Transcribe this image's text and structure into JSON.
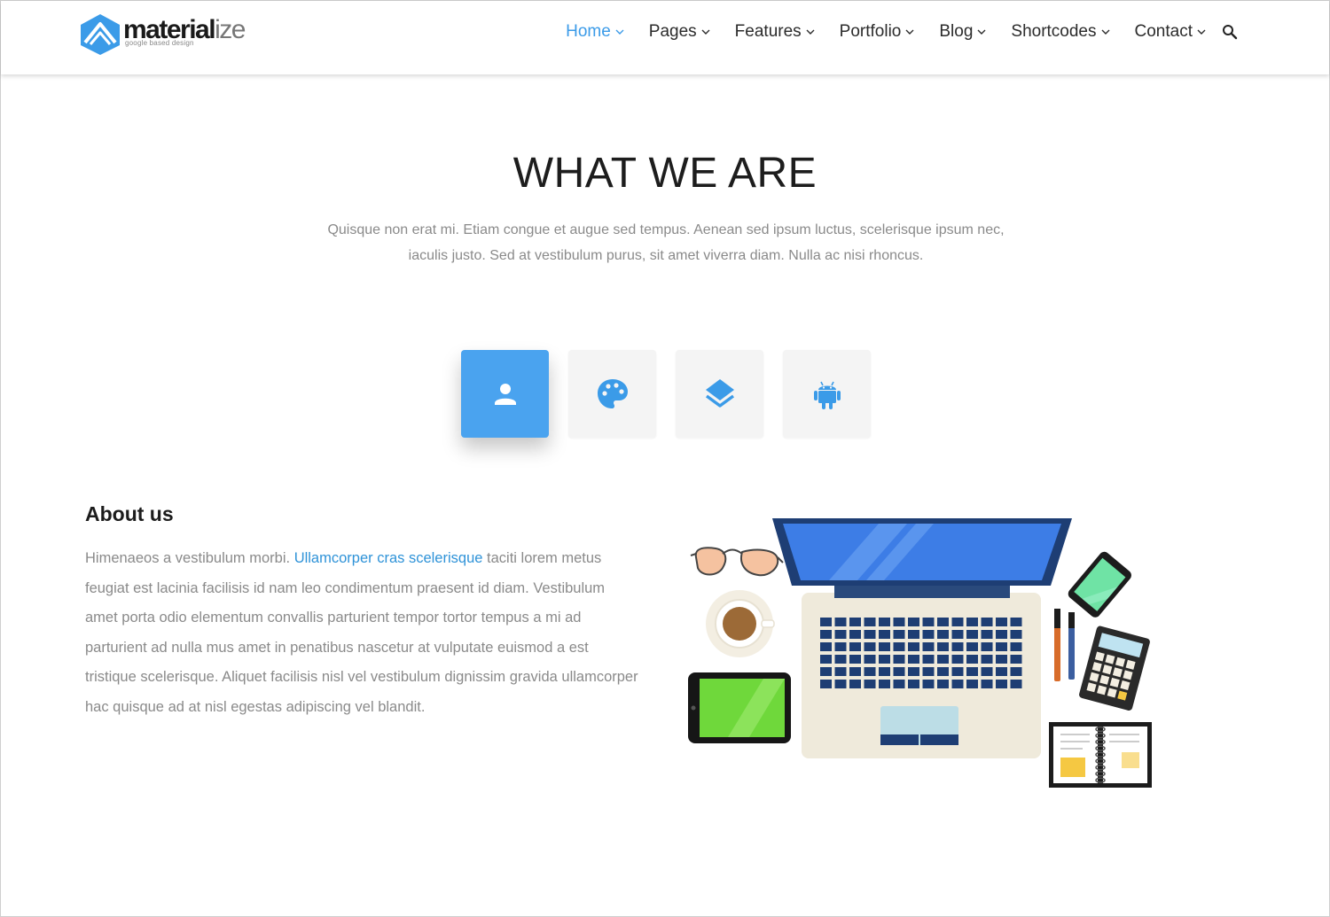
{
  "brand": {
    "name_bold": "material",
    "name_light": "ize",
    "tagline": "google based design",
    "color": "#3b9be8"
  },
  "nav": {
    "items": [
      {
        "label": "Home",
        "active": true
      },
      {
        "label": "Pages",
        "active": false
      },
      {
        "label": "Features",
        "active": false
      },
      {
        "label": "Portfolio",
        "active": false
      },
      {
        "label": "Blog",
        "active": false
      },
      {
        "label": "Shortcodes",
        "active": false
      },
      {
        "label": "Contact",
        "active": false
      }
    ],
    "search_icon": "search-icon"
  },
  "hero": {
    "title": "WHAT WE ARE",
    "subtitle": "Quisque non erat mi. Etiam congue et augue sed tempus. Aenean sed ipsum luctus, scelerisque ipsum nec, iaculis justo. Sed at vestibulum purus, sit amet viverra diam. Nulla ac nisi rhoncus."
  },
  "tabs": [
    {
      "icon": "person-icon",
      "active": true
    },
    {
      "icon": "palette-icon",
      "active": false
    },
    {
      "icon": "layers-icon",
      "active": false
    },
    {
      "icon": "android-icon",
      "active": false
    }
  ],
  "about": {
    "title": "About us",
    "text_before_link": "Himenaeos a vestibulum morbi. ",
    "link_text": "Ullamcorper cras scelerisque",
    "text_after_link": " taciti lorem metus feugiat est lacinia facilisis id nam leo condimentum praesent id diam. Vestibulum amet porta odio elementum convallis parturient tempor tortor tempus a mi ad parturient ad nulla mus amet in penatibus nascetur at vulputate euismod a est tristique scelerisque. Aliquet facilisis nisl vel vestibulum dignissim gravida ullamcorper hac quisque ad at nisl egestas adipiscing vel blandit."
  },
  "colors": {
    "accent": "#4aa3ef",
    "link": "#2f93d8",
    "body_text": "#8a8a8a"
  }
}
